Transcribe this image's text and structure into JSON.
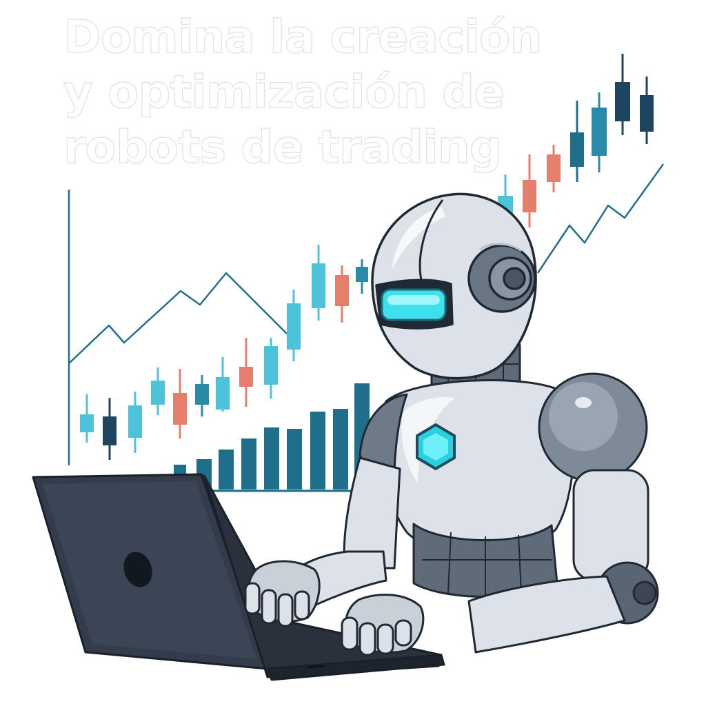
{
  "headline": {
    "lines": [
      "Domina la creación",
      "y optimización de",
      "robots de trading"
    ]
  },
  "colors": {
    "teal_dark": "#1f6e8c",
    "teal_mid": "#2a8ba8",
    "cyan": "#4cc3d9",
    "salmon": "#e67e6c",
    "navy": "#1d4460",
    "robot_body": "#dde2e8",
    "robot_dark": "#555f6c",
    "visor": "#3ee0ee",
    "laptop": "#343c4b"
  },
  "icons": [
    "laptop-logo-icon",
    "robot-chest-hexagon-icon"
  ]
}
